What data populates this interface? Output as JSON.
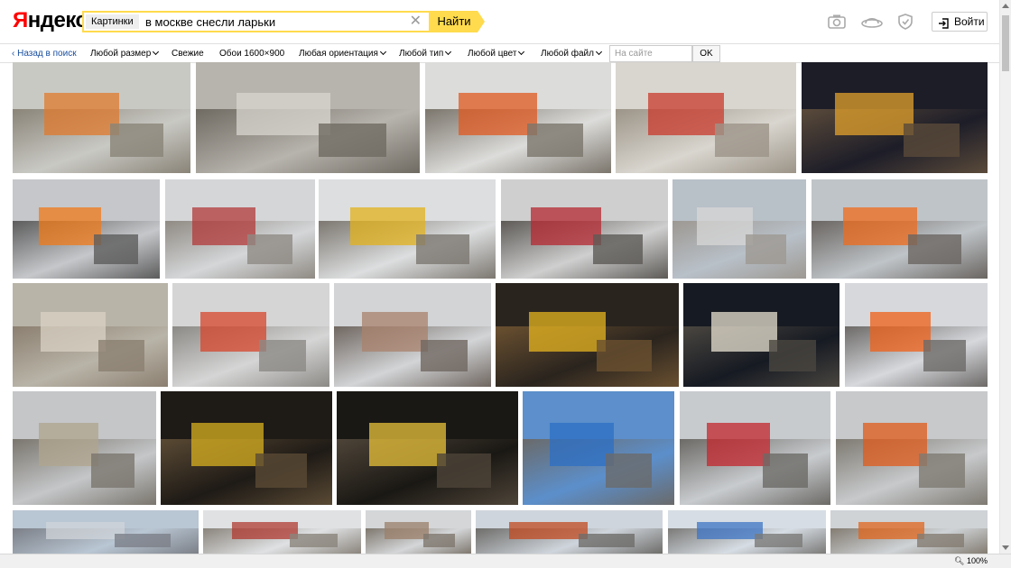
{
  "header": {
    "logo_part1": "Я",
    "logo_part2": "ндекс",
    "search_tag": "Картинки",
    "search_query": "в москве снесли ларьки",
    "find_button": "Найти",
    "login_button": "Войти"
  },
  "filters": {
    "back": "Назад в поиск",
    "size": "Любой размер",
    "fresh": "Свежие",
    "wallpapers": "Обои 1600×900",
    "orientation": "Любая ориентация",
    "type": "Любой тип",
    "color": "Любой цвет",
    "file": "Любой файл",
    "site_placeholder": "На сайте",
    "ok": "OK"
  },
  "status": {
    "zoom": "100%"
  },
  "palette": {
    "brand_red": "#ff0000",
    "search_yellow": "#ffdb4d",
    "link_blue": "#1a4fa0"
  },
  "images": [
    {
      "scene": "demolition-debris-aerial",
      "sky": "#c9c9c4",
      "ground": "#8a8478",
      "accent": "#e07a2c"
    },
    {
      "scene": "metro-pavilion-rubble",
      "sky": "#b7b4ad",
      "ground": "#6f6a62",
      "accent": "#d8d5cf"
    },
    {
      "scene": "workers-kiosk-ruins",
      "sky": "#dcdcda",
      "ground": "#7b756c",
      "accent": "#e05a20"
    },
    {
      "scene": "kiosk-cvety-demolished",
      "sky": "#d9d6cf",
      "ground": "#9c9488",
      "accent": "#c93a2c"
    },
    {
      "scene": "excavator-night",
      "sky": "#1d1d28",
      "ground": "#5a4a3a",
      "accent": "#e3a22c"
    },
    {
      "scene": "worker-orange-wrecked-kiosk",
      "sky": "#c5c7ca",
      "ground": "#5c5c5c",
      "accent": "#f07a18"
    },
    {
      "scene": "rubble-cathedral",
      "sky": "#d4d6d8",
      "ground": "#8f8a83",
      "accent": "#b33a3a"
    },
    {
      "scene": "yellow-excavator-day",
      "sky": "#dcdedf",
      "ground": "#7c7770",
      "accent": "#e2b21c"
    },
    {
      "scene": "kiosk-obuv-ruins",
      "sky": "#cfcfcf",
      "ground": "#5d5a56",
      "accent": "#b52832"
    },
    {
      "scene": "snowy-rubble-street",
      "sky": "#b8c0c8",
      "ground": "#9d9892",
      "accent": "#d7d7d7"
    },
    {
      "scene": "workers-dog-street",
      "sky": "#bfc4c8",
      "ground": "#6a6561",
      "accent": "#ef6b1c"
    },
    {
      "scene": "rubble-pile-yard",
      "sky": "#b9b4a8",
      "ground": "#8b7f70",
      "accent": "#d9d2c4"
    },
    {
      "scene": "glass-kiosk-workers",
      "sky": "#d5d5d5",
      "ground": "#8c8a86",
      "accent": "#d6452c"
    },
    {
      "scene": "street-ruins-lamp",
      "sky": "#d2d4d6",
      "ground": "#6f6660",
      "accent": "#a9826c"
    },
    {
      "scene": "excavator-worker-night",
      "sky": "#2a241e",
      "ground": "#6a5030",
      "accent": "#e6b420"
    },
    {
      "scene": "metro-night",
      "sky": "#161a22",
      "ground": "#4a4640",
      "accent": "#e8e2d2"
    },
    {
      "scene": "crane-truck-kiosk",
      "sky": "#d6d8dc",
      "ground": "#6d6a68",
      "accent": "#ef6018"
    },
    {
      "scene": "metal-frame-debris",
      "sky": "#c4c6c8",
      "ground": "#7a766e",
      "accent": "#b0a48e"
    },
    {
      "scene": "metro-excavator-night",
      "sky": "#1e1a16",
      "ground": "#5a4a34",
      "accent": "#d8b020"
    },
    {
      "scene": "excavator-pavilion-night",
      "sky": "#1a1814",
      "ground": "#4e4438",
      "accent": "#e8c23a"
    },
    {
      "scene": "mosinform-crane",
      "sky": "#5c8fcb",
      "ground": "#6a6a6a",
      "accent": "#2c6fc4"
    },
    {
      "scene": "kiosk-on-truck",
      "sky": "#c8cbce",
      "ground": "#6c6a66",
      "accent": "#c3262c"
    },
    {
      "scene": "bobcat-loader",
      "sky": "#c7c9cb",
      "ground": "#7e7a72",
      "accent": "#e05a1a"
    },
    {
      "scene": "partial-kiosk-glass",
      "sky": "#b9c6d3",
      "ground": "#7c8088",
      "accent": "#d0d4da"
    },
    {
      "scene": "partial-tree-building",
      "sky": "#dfe1e3",
      "ground": "#8a847c",
      "accent": "#b03a32"
    },
    {
      "scene": "partial-building-worker",
      "sky": "#d4d6d8",
      "ground": "#7e776e",
      "accent": "#9b7f6a"
    },
    {
      "scene": "partial-street-cars",
      "sky": "#cfd5dc",
      "ground": "#6e6d6a",
      "accent": "#c24a20"
    },
    {
      "scene": "partial-pavilion-street",
      "sky": "#d6dde4",
      "ground": "#7b7a78",
      "accent": "#3c74c4"
    },
    {
      "scene": "partial-worker-debris",
      "sky": "#cfd3d6",
      "ground": "#837c72",
      "accent": "#e0661c"
    }
  ]
}
